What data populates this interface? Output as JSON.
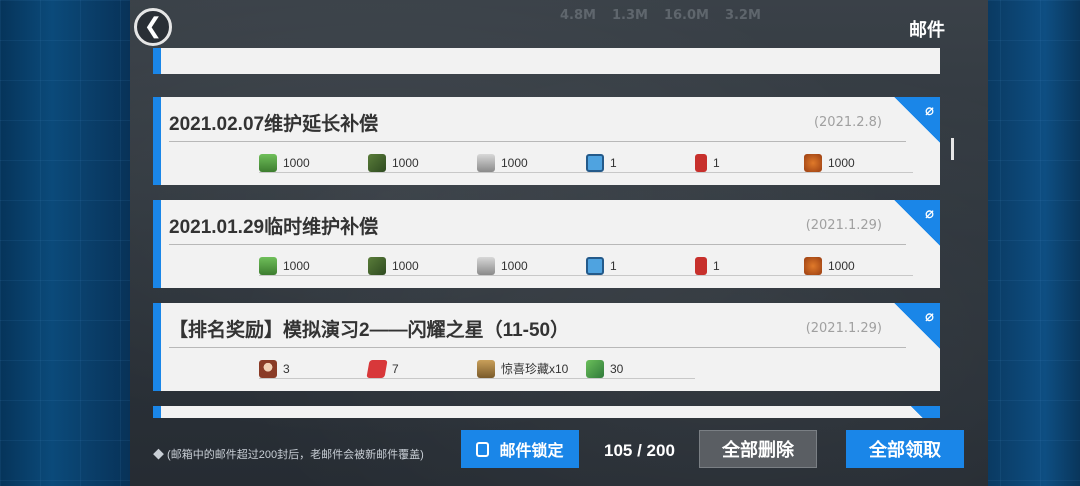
{
  "header": {
    "back_glyph": "❮",
    "title": "邮件",
    "resources": [
      "4.8M",
      "1.3M",
      "16.0M",
      "3.2M"
    ]
  },
  "mails": [
    {
      "title": "",
      "date": "",
      "items": []
    },
    {
      "title": "2021.02.07维护延长补偿",
      "date": "(2021.2.8)",
      "items": [
        {
          "icon": "oil-icon",
          "qty": "1000"
        },
        {
          "icon": "ammo-icon",
          "qty": "1000"
        },
        {
          "icon": "steel-icon",
          "qty": "1000"
        },
        {
          "icon": "gear-ticket-icon",
          "qty": "1"
        },
        {
          "icon": "extinguisher-icon",
          "qty": "1"
        },
        {
          "icon": "food-icon",
          "qty": "1000"
        }
      ]
    },
    {
      "title": "2021.01.29临时维护补偿",
      "date": "(2021.1.29)",
      "items": [
        {
          "icon": "oil-icon",
          "qty": "1000"
        },
        {
          "icon": "ammo-icon",
          "qty": "1000"
        },
        {
          "icon": "steel-icon",
          "qty": "1000"
        },
        {
          "icon": "gear-ticket-icon",
          "qty": "1"
        },
        {
          "icon": "extinguisher-icon",
          "qty": "1"
        },
        {
          "icon": "food-icon",
          "qty": "1000"
        }
      ]
    },
    {
      "title": "【排名奖励】模拟演习2——闪耀之星（11-50）",
      "date": "(2021.1.29)",
      "items": [
        {
          "icon": "doll-icon",
          "qty": "3"
        },
        {
          "icon": "book-icon",
          "qty": "7"
        },
        {
          "icon": "box-icon",
          "qty": "惊喜珍藏x10"
        },
        {
          "icon": "ticket-icon",
          "qty": "30"
        }
      ]
    }
  ],
  "footer": {
    "note": "◆ (邮箱中的邮件超过200封后，老邮件会被新邮件覆盖)",
    "lock_label": "邮件锁定",
    "count": "105 / 200",
    "delete_all_label": "全部删除",
    "claim_all_label": "全部领取"
  },
  "colors": {
    "accent": "#1a86e8",
    "card_bg": "#f2f2f2",
    "panel_bg": "#2d343b"
  }
}
